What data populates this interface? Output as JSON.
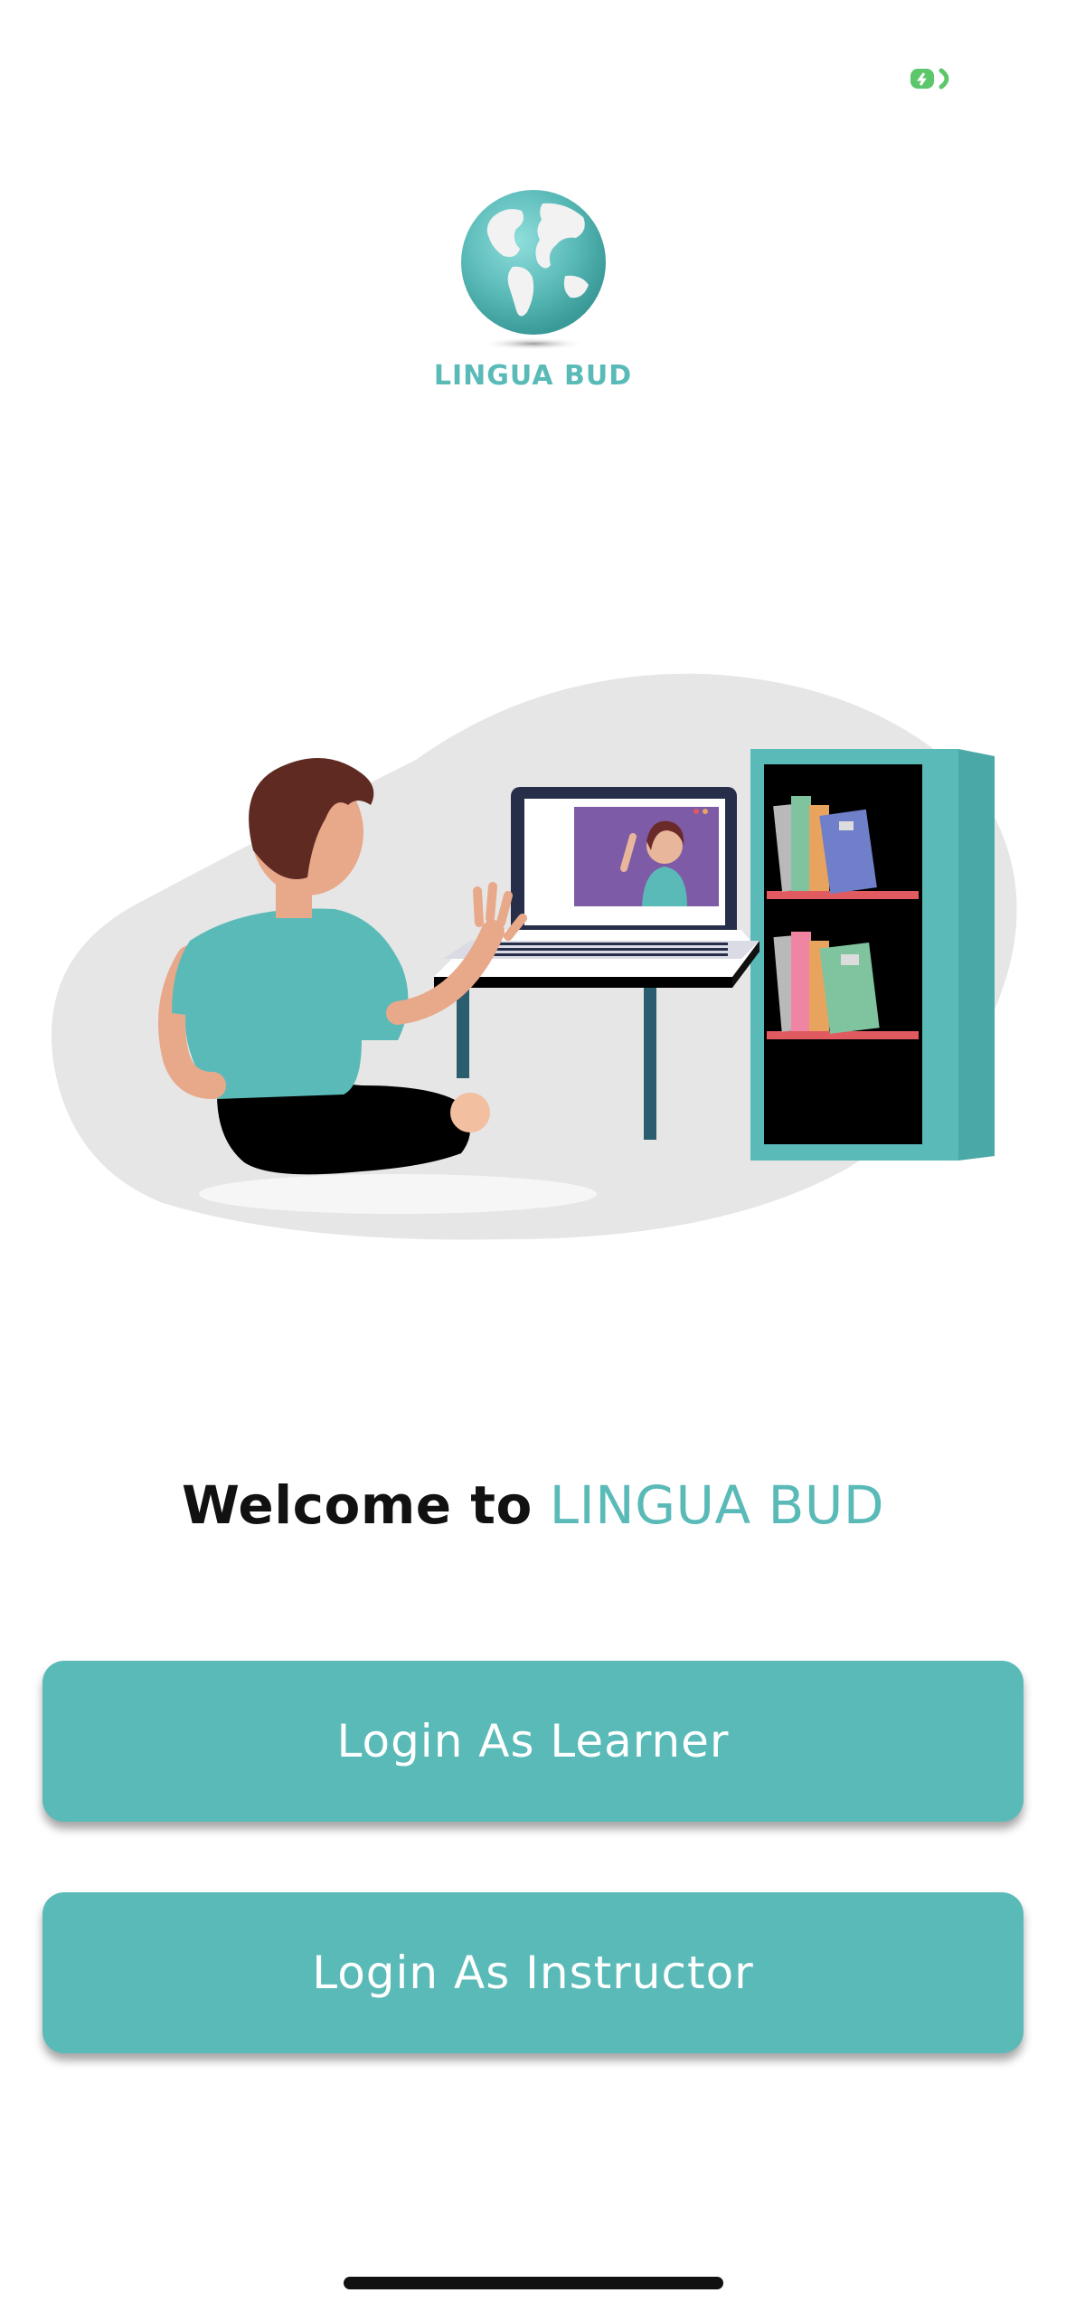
{
  "app": {
    "logo_text": "LINGUA BUD"
  },
  "welcome": {
    "prefix": "Welcome to",
    "brand": "LINGUA BUD"
  },
  "buttons": {
    "learner_label": "Login As Learner",
    "instructor_label": "Login As Instructor"
  },
  "colors": {
    "brand_teal": "#5abab8",
    "status_green": "#5cc66b",
    "text_dark": "#111111"
  },
  "icons": {
    "status": "battery-charging-icon",
    "logo": "globe-icon"
  }
}
